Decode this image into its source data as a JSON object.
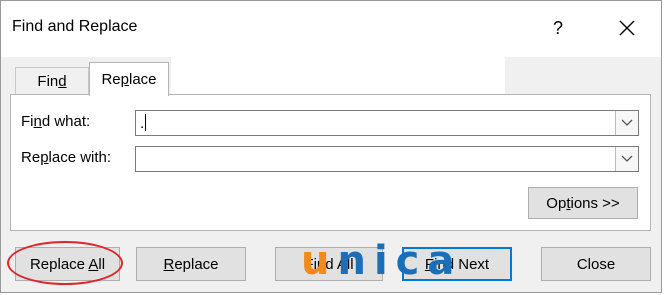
{
  "window": {
    "title": "Find and Replace",
    "help_label": "?"
  },
  "tabs": [
    {
      "pre": "Fin",
      "key": "d",
      "post": ""
    },
    {
      "pre": "Re",
      "key": "p",
      "post": "lace"
    }
  ],
  "fields": {
    "find": {
      "pre": "Fi",
      "key": "n",
      "post": "d what:",
      "value": "."
    },
    "replace": {
      "pre": "Re",
      "key": "p",
      "post": "lace with:",
      "value": ""
    }
  },
  "buttons": {
    "options": {
      "pre": "Op",
      "key": "t",
      "post": "ions >>"
    },
    "replace_all": {
      "pre": "Replace ",
      "key": "A",
      "post": "ll"
    },
    "replace": {
      "pre": "",
      "key": "R",
      "post": "eplace"
    },
    "find_all": {
      "pre": "F",
      "key": "i",
      "post": "nd All"
    },
    "find_next": {
      "pre": "",
      "key": "F",
      "post": "ind Next"
    },
    "close": {
      "pre": "Close",
      "key": "",
      "post": ""
    }
  },
  "watermark": {
    "first": "u",
    "rest": "nica"
  },
  "colors": {
    "accent": "#0078d7",
    "annotation": "#e0242b",
    "brand_orange": "#f38a1b",
    "brand_blue": "#1b6fb8"
  }
}
